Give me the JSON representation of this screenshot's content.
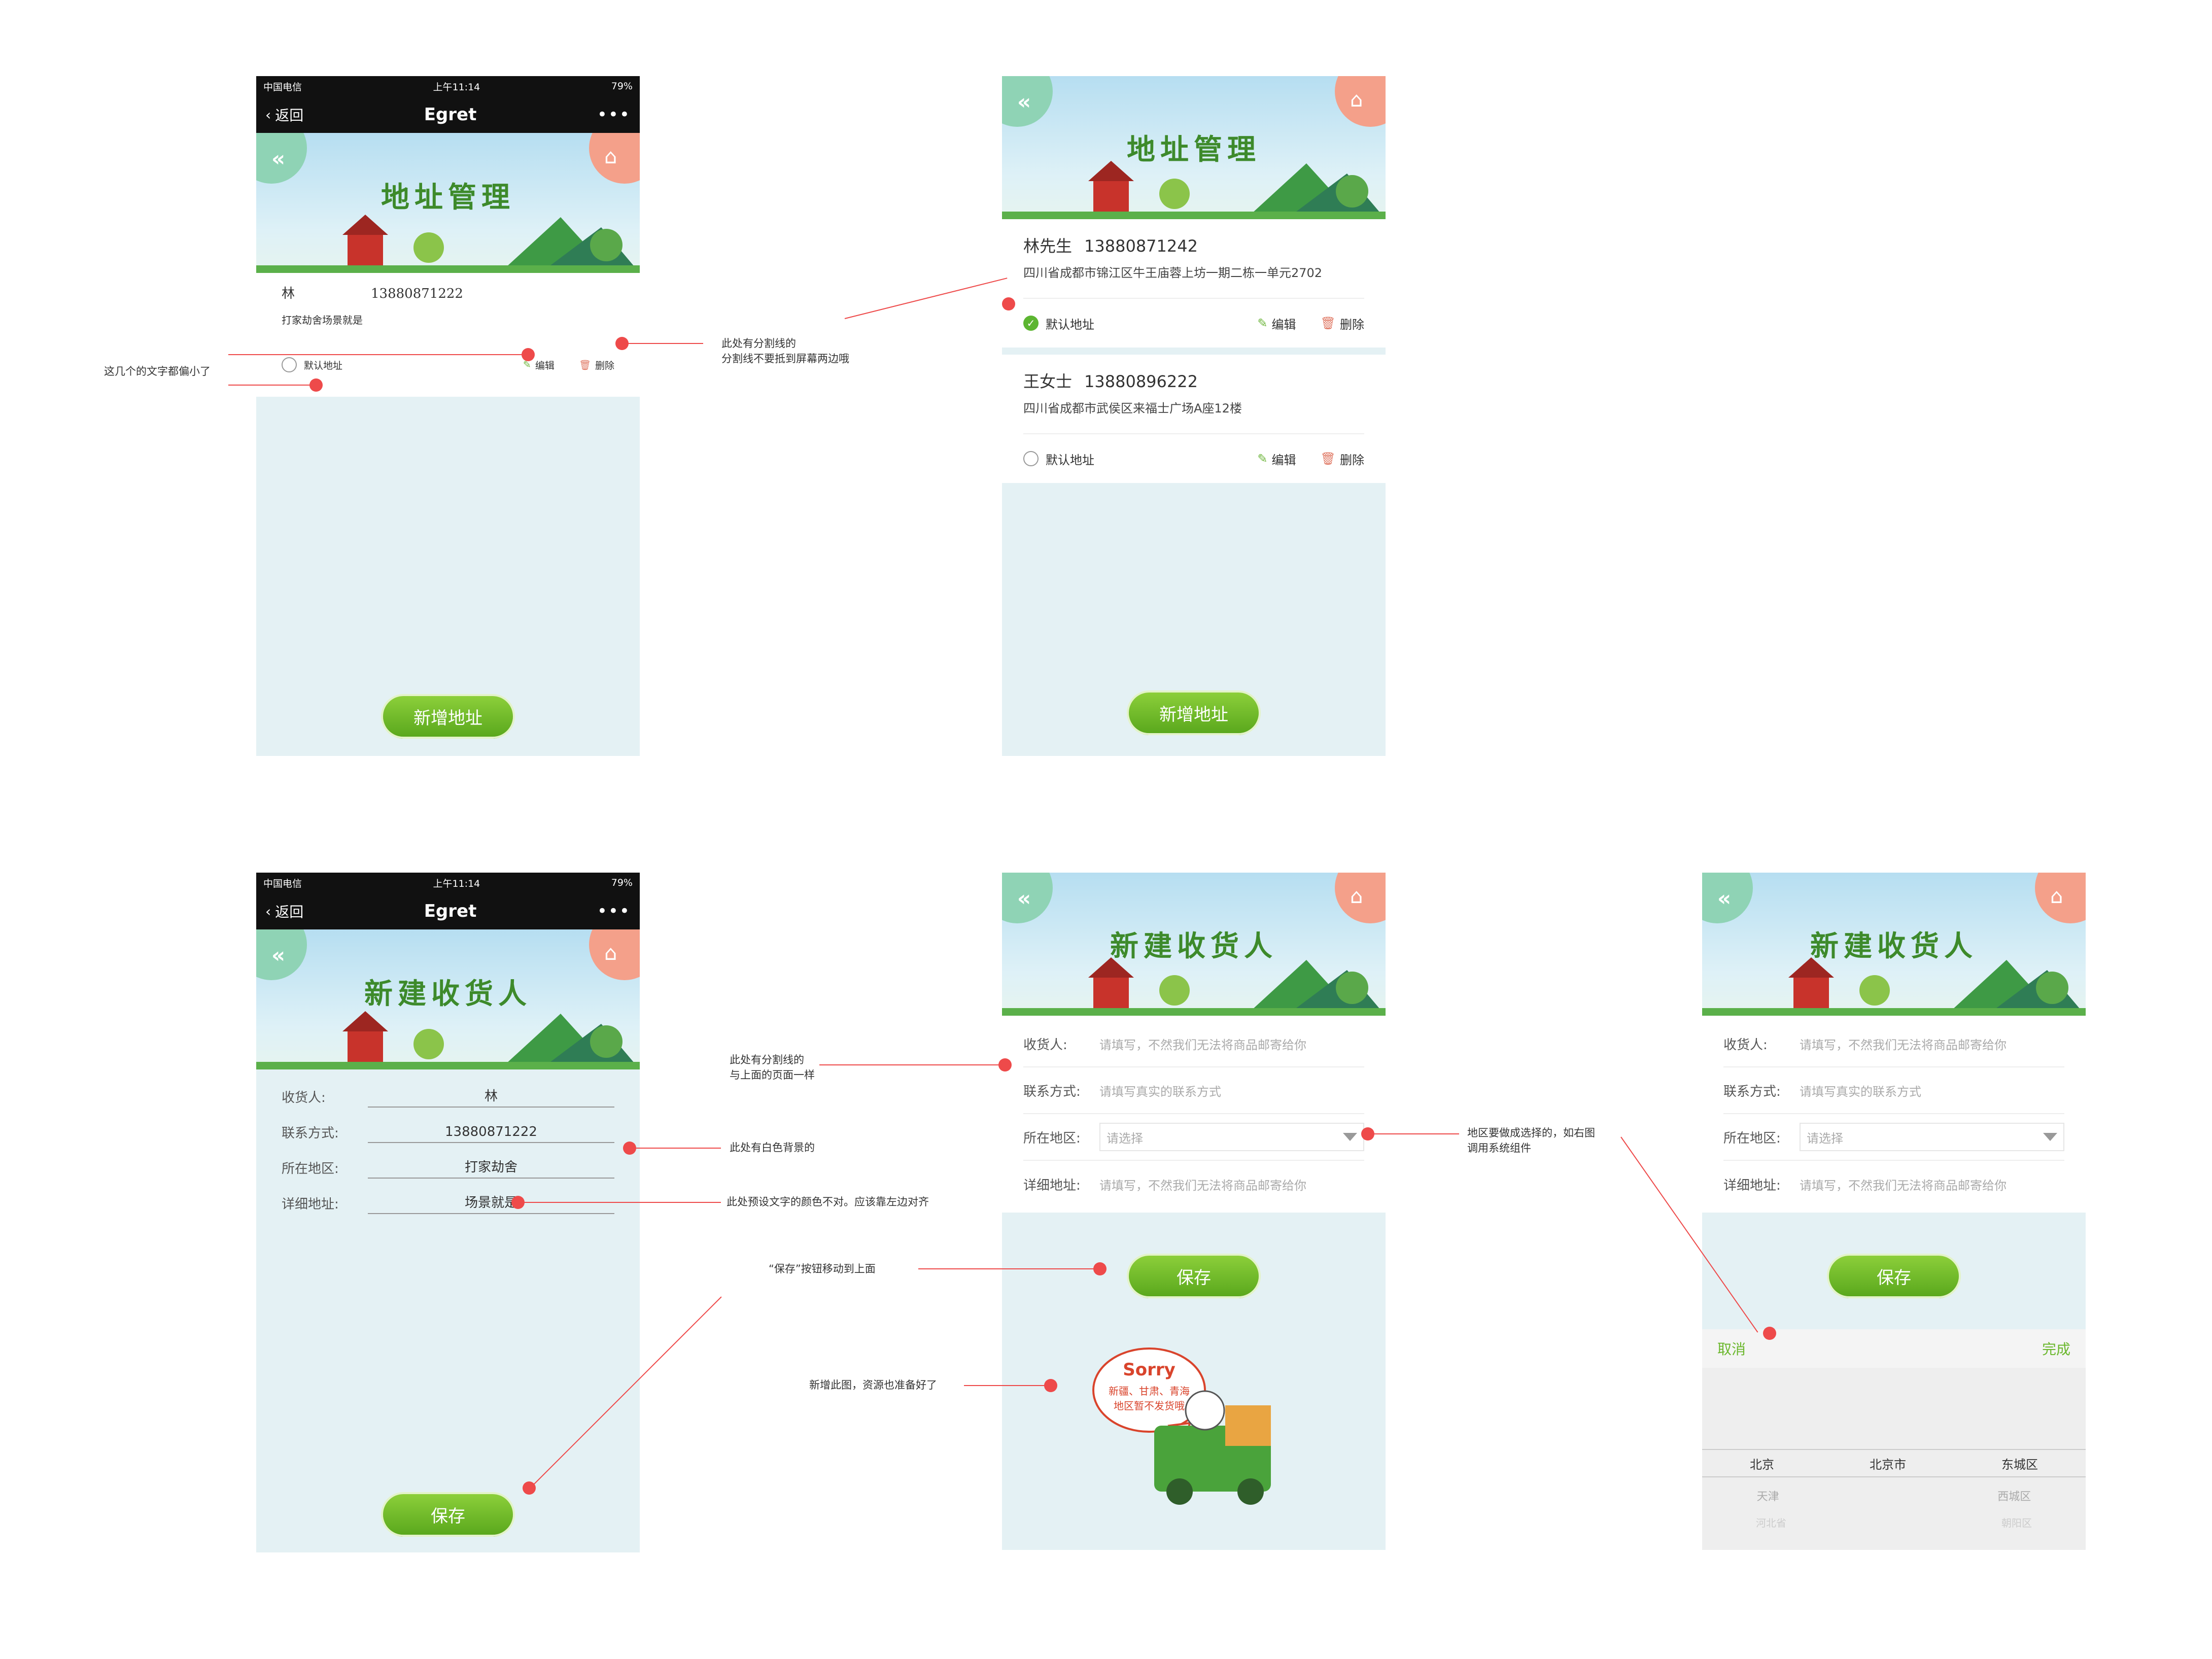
{
  "wechat": {
    "carrier": "中国电信",
    "time": "上午11:14",
    "battery": "79%",
    "back": "返回",
    "title": "Egret",
    "more": "•••"
  },
  "banner": {
    "addr_title": "地址管理",
    "new_title": "新建收货人"
  },
  "s1": {
    "name": "林",
    "phone": "13880871222",
    "detail": "打家劫舍场景就是",
    "default": "默认地址",
    "edit": "编辑",
    "delete": "删除",
    "add": "新增地址"
  },
  "s2": {
    "items": [
      {
        "name": "林先生",
        "phone": "13880871242",
        "detail": "四川省成都市锦江区牛王庙蓉上坊一期二栋一单元2702",
        "default": "默认地址",
        "edit": "编辑",
        "delete": "删除"
      },
      {
        "name": "王女士",
        "phone": "13880896222",
        "detail": "四川省成都市武侯区来福士广场A座12楼",
        "default": "默认地址",
        "edit": "编辑",
        "delete": "删除"
      }
    ],
    "add": "新增地址"
  },
  "s3": {
    "fields": [
      {
        "label": "收货人:",
        "value": "林"
      },
      {
        "label": "联系方式:",
        "value": "13880871222"
      },
      {
        "label": "所在地区:",
        "value": "打家劫舍"
      },
      {
        "label": "详细地址:",
        "value": "场景就是"
      }
    ],
    "save": "保存"
  },
  "form": {
    "receiver_label": "收货人:",
    "receiver_ph": "请填写，不然我们无法将商品邮寄给你",
    "phone_label": "联系方式:",
    "phone_ph": "请填写真实的联系方式",
    "area_label": "所在地区:",
    "area_ph": "请选择",
    "addr_label": "详细地址:",
    "addr_ph": "请填写，不然我们无法将商品邮寄给你",
    "save": "保存"
  },
  "sorry": {
    "title": "Sorry",
    "line1": "新疆、甘肃、青海",
    "line2": "地区暂不发货哦"
  },
  "picker": {
    "cancel": "取消",
    "done": "完成",
    "row1": [
      "北京",
      "北京市",
      "东城区"
    ],
    "row2": [
      "天津",
      "",
      "西城区"
    ],
    "row3": [
      "河北省",
      "",
      "朝阳区"
    ]
  },
  "notes": {
    "n1": "这几个的文字都偏小了",
    "n2a": "此处有分割线的",
    "n2b": "分割线不要抵到屏幕两边哦",
    "n3a": "此处有分割线的",
    "n3b": "与上面的页面一样",
    "n4": "此处有白色背景的",
    "n5": "此处预设文字的颜色不对。应该靠左边对齐",
    "n6": "“保存”按钮移动到上面",
    "n7": "新增此图，资源也准备好了",
    "n8a": "地区要做成选择的，如右图",
    "n8b": "调用系统组件"
  },
  "colors": {
    "accent": "#6ab72c",
    "annotation": "#ee4a4a",
    "bg": "#e4f1f4"
  }
}
